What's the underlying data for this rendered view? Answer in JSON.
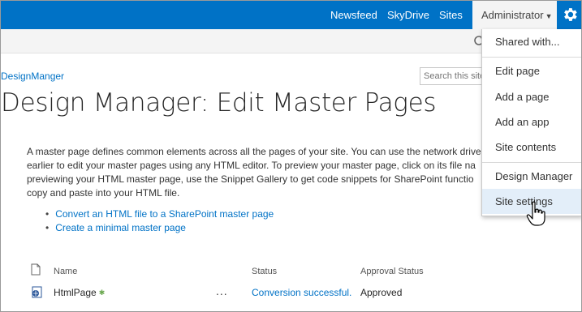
{
  "suitebar": {
    "links": [
      "Newsfeed",
      "SkyDrive",
      "Sites"
    ],
    "user": "Administrator",
    "colors": {
      "bar": "#0072c6",
      "link": "#0072c6"
    }
  },
  "breadcrumb": "DesignManger",
  "title": "Design Manager: Edit Master Pages",
  "search": {
    "placeholder": "Search this site"
  },
  "description": [
    "A master page defines common elements across all the pages of your site. You can use the network drive",
    "earlier to edit your master pages using any HTML editor. To preview your master page, click on its file na",
    "previewing your HTML master page, use the Snippet Gallery to get code snippets for SharePoint functio",
    "copy and paste into your HTML file."
  ],
  "links": [
    "Convert an HTML file to a SharePoint master page",
    "Create a minimal master page"
  ],
  "table": {
    "headers": {
      "name": "Name",
      "status": "Status",
      "approval": "Approval Status"
    },
    "rows": [
      {
        "name": "HtmlPage",
        "status": "Conversion successful.",
        "approval": "Approved",
        "menu": "..."
      }
    ]
  },
  "menu": {
    "items": [
      "Shared with...",
      "Edit page",
      "Add a page",
      "Add an app",
      "Site contents",
      "Design Manager",
      "Site settings"
    ],
    "hovered": "Site settings"
  }
}
